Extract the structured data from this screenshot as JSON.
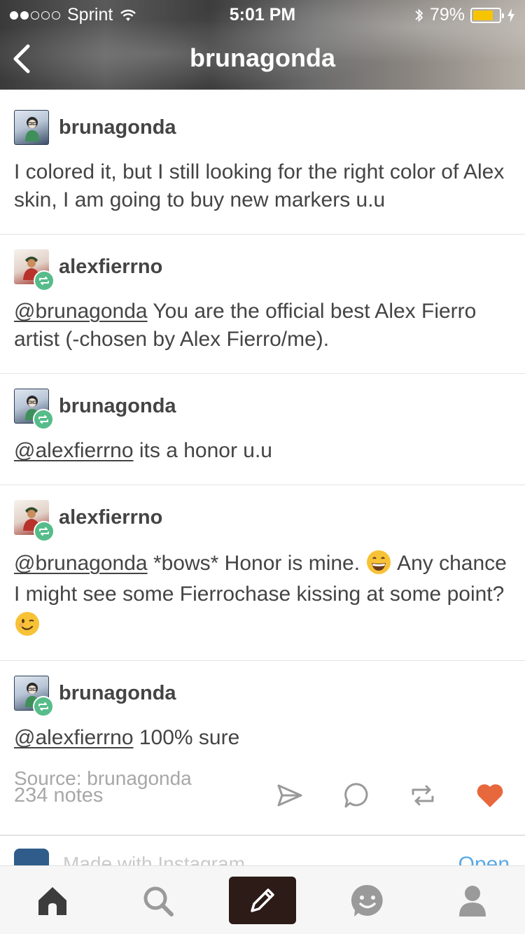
{
  "status_bar": {
    "carrier": "Sprint",
    "time": "5:01 PM",
    "battery_percent": "79%",
    "battery_level": 0.79
  },
  "nav": {
    "title": "brunagonda"
  },
  "thread": [
    {
      "username": "brunagonda",
      "avatar": "brunagonda",
      "reblog": false,
      "mention": "",
      "text": "I colored it, but I still looking for the right color of Alex skin, I am going to buy new markers u.u"
    },
    {
      "username": "alexfierrno",
      "avatar": "alexfierrno",
      "reblog": true,
      "mention": "@brunagonda",
      "text": " You are the official best Alex Fierro artist (-chosen by Alex Fierro/me)."
    },
    {
      "username": "brunagonda",
      "avatar": "brunagonda",
      "reblog": true,
      "mention": "@alexfierrno",
      "text": " its a honor u.u"
    },
    {
      "username": "alexfierrno",
      "avatar": "alexfierrno",
      "reblog": true,
      "mention": "@brunagonda",
      "text_part1": " *bows* Honor is mine. ",
      "emoji1": "grinning-face-emoji",
      "text_part2": " Any chance I might see some Fierrochase kissing at some point? ",
      "emoji2": "winking-face-emoji"
    },
    {
      "username": "brunagonda",
      "avatar": "brunagonda",
      "reblog": true,
      "mention": "@alexfierrno",
      "text": " 100% sure"
    }
  ],
  "post_footer": {
    "source": "Source: brunagonda",
    "notes": "234 notes",
    "actions": [
      "share-icon",
      "reply-icon",
      "reblog-icon",
      "like-icon"
    ]
  },
  "next_post_peek": {
    "text": "Made with Instagram",
    "action": "Open"
  },
  "tab_bar": {
    "tabs": [
      "home-icon",
      "search-icon",
      "compose-icon",
      "inbox-icon",
      "account-icon"
    ]
  },
  "colors": {
    "reblog_green": "#56bc8a",
    "like_orange": "#e8683d",
    "battery_yellow": "#f6c400",
    "compose_bg": "#2c1b17",
    "muted_text": "#a7a7a7",
    "link_blue": "#5aa9e6"
  }
}
